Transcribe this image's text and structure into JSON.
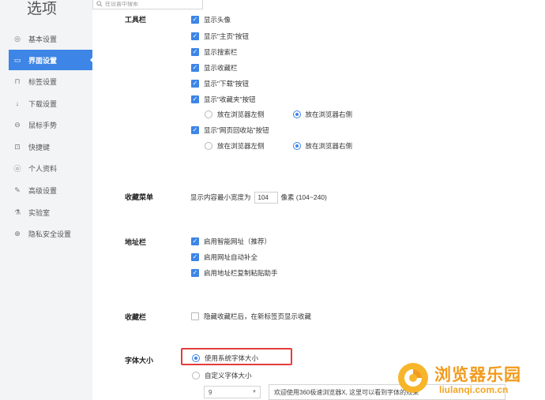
{
  "sidebar": {
    "title": "选项",
    "items": [
      {
        "label": "基本设置",
        "icon": "settings-icon",
        "glyph": "◎"
      },
      {
        "label": "界面设置",
        "icon": "window-icon",
        "glyph": "▭"
      },
      {
        "label": "标签设置",
        "icon": "tab-icon",
        "glyph": "⊓"
      },
      {
        "label": "下载设置",
        "icon": "download-icon",
        "glyph": "↓"
      },
      {
        "label": "鼠标手势",
        "icon": "mouse-icon",
        "glyph": "⊖"
      },
      {
        "label": "快捷键",
        "icon": "keyboard-icon",
        "glyph": "⊡"
      },
      {
        "label": "个人资料",
        "icon": "user-icon",
        "glyph": "ⓞ"
      },
      {
        "label": "高级设置",
        "icon": "wrench-icon",
        "glyph": "✎"
      },
      {
        "label": "实验室",
        "icon": "lab-icon",
        "glyph": "⚗"
      },
      {
        "label": "隐私安全设置",
        "icon": "shield-icon",
        "glyph": "⊕"
      }
    ],
    "active_index": 1
  },
  "search": {
    "placeholder": "在设置中搜索"
  },
  "toolbar": {
    "label": "工具栏",
    "options": [
      {
        "label": "显示头像",
        "checked": true
      },
      {
        "label": "显示\"主页\"按钮",
        "checked": true
      },
      {
        "label": "显示搜索栏",
        "checked": true
      },
      {
        "label": "显示收藏栏",
        "checked": true
      },
      {
        "label": "显示\"下载\"按钮",
        "checked": true
      },
      {
        "label": "显示\"收藏夹\"按钮",
        "checked": true
      }
    ],
    "fav_position": {
      "left": "放在浏览器左侧",
      "right": "放在浏览器右侧",
      "selected": "right"
    },
    "recycle": {
      "label": "显示\"网页回收站\"按钮",
      "checked": true
    },
    "recycle_position": {
      "left": "放在浏览器左侧",
      "right": "放在浏览器右侧",
      "selected": "right"
    }
  },
  "fav_menu": {
    "label": "收藏菜单",
    "prefix": "显示内容最小宽度为",
    "value": "104",
    "suffix": "像素 (104~240)"
  },
  "address_bar": {
    "label": "地址栏",
    "options": [
      {
        "label": "启用智能网址（推荐）",
        "checked": true
      },
      {
        "label": "启用网址自动补全",
        "checked": true
      },
      {
        "label": "启用地址栏复制粘贴助手",
        "checked": true
      }
    ]
  },
  "fav_bar": {
    "label": "收藏栏",
    "option": {
      "label": "隐藏收藏栏后，在新标签页显示收藏",
      "checked": false
    }
  },
  "font_size": {
    "label": "字体大小",
    "system": "使用系统字体大小",
    "custom": "自定义字体大小",
    "selected": "system",
    "size_value": "9",
    "preview_text": "欢迎使用360极速浏览器X, 这里可以看到字体的效果"
  },
  "watermark": {
    "title": "浏览器乐园",
    "url": "liulanqi.com.cn"
  },
  "colors": {
    "accent": "#3d85e6",
    "highlight": "#e53c3c",
    "watermark": "#f29b1c"
  }
}
